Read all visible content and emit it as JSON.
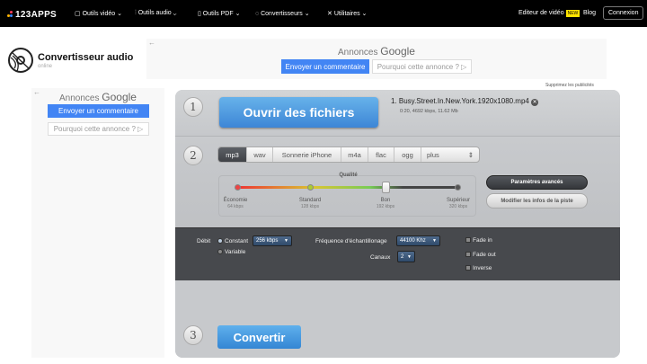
{
  "topbar": {
    "brand": "123APPS",
    "nav": [
      "Outils vidéo",
      "Outils audio",
      "Outils PDF",
      "Convertisseurs",
      "Utilitaires"
    ],
    "editor": "Editeur de vidéo",
    "new_badge": "NEW",
    "blog": "Blog",
    "login": "Connexion"
  },
  "app": {
    "title": "Convertisseur audio",
    "subtitle": "online"
  },
  "ads": {
    "label": "Annonces",
    "brand": "Google",
    "feedback": "Envoyer un commentaire",
    "why": "Pourquoi cette annonce ?",
    "remove": "Supprimez les publicités"
  },
  "step1": {
    "num": "1",
    "open": "Ouvrir des fichiers",
    "file_name": "1. Busy.Street.In.New.York.1920x1080.mp4",
    "file_meta": "0:20, 4692 kbps, 11.62 Mb"
  },
  "step2": {
    "num": "2",
    "formats": [
      "mp3",
      "wav",
      "Sonnerie iPhone",
      "m4a",
      "flac",
      "ogg",
      "plus"
    ],
    "selected_format": "mp3",
    "quality_title": "Qualité",
    "quality_levels": [
      {
        "name": "Économie",
        "rate": "64 kbps"
      },
      {
        "name": "Standard",
        "rate": "128 kbps"
      },
      {
        "name": "Bon",
        "rate": "192 kbps"
      },
      {
        "name": "Supérieur",
        "rate": "320 kbps"
      }
    ],
    "quality_selected": "Bon",
    "advanced": "Paramètres avancés",
    "edit_info": "Modifier les infos de la piste"
  },
  "advanced": {
    "bitrate_label": "Débit",
    "constant": "Constant",
    "variable": "Variable",
    "bitrate": "256 kbps",
    "freq_label": "Fréquence d'échantillonage",
    "freq": "44100 Khz",
    "channels_label": "Canaux",
    "channels": "2",
    "fade_in": "Fade in",
    "fade_out": "Fade out",
    "reverse": "Inverse"
  },
  "step3": {
    "num": "3",
    "convert": "Convertir"
  }
}
